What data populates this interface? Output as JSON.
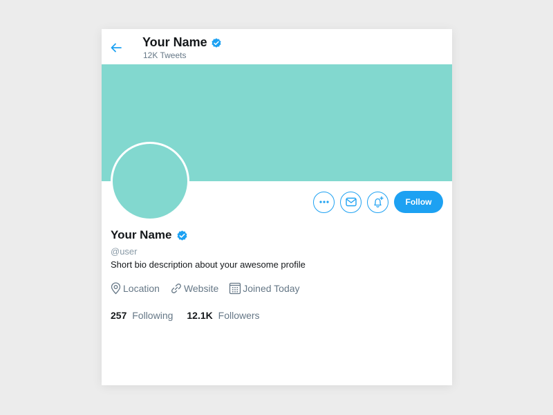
{
  "colors": {
    "accent": "#1da1f2",
    "banner": "#82d8cf",
    "avatar": "#82d8cf",
    "background": "#ececec"
  },
  "header": {
    "back_icon": "arrow-left-icon",
    "name": "Your Name",
    "verified_icon": "verified-badge-icon",
    "tweet_count": "12K Tweets"
  },
  "actions": {
    "more_icon": "more-horizontal-icon",
    "message_icon": "envelope-icon",
    "notify_icon": "bell-plus-icon",
    "follow_label": "Follow"
  },
  "profile": {
    "name": "Your Name",
    "handle": "@user",
    "bio": "Short bio description about your awesome profile",
    "meta": {
      "location": "Location",
      "website": "Website",
      "joined": "Joined Today"
    },
    "stats": {
      "following_count": "257",
      "following_label": "Following",
      "followers_count": "12.1K",
      "followers_label": "Followers"
    }
  }
}
